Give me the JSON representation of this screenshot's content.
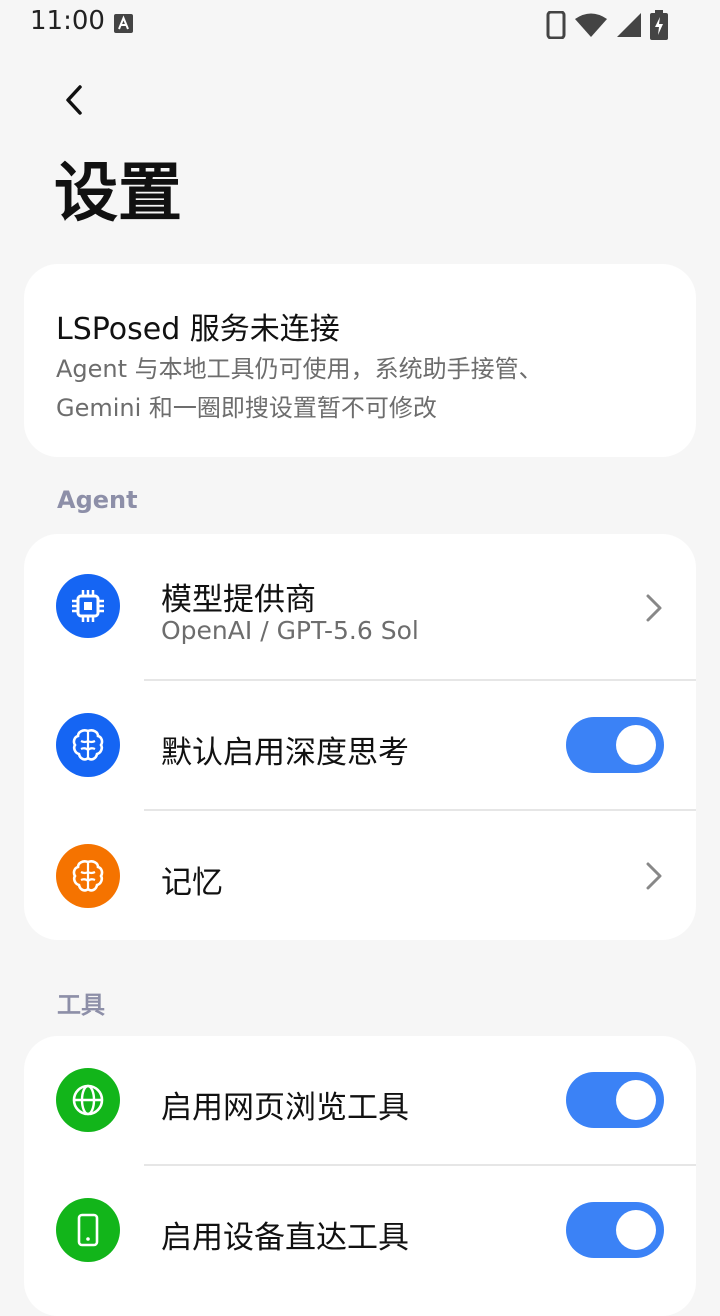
{
  "status_bar": {
    "time": "11:00"
  },
  "header": {
    "title": "设置"
  },
  "lsposed_card": {
    "title": "LSPosed 服务未连接",
    "desc_line1": "Agent 与本地工具仍可使用，系统助手接管、",
    "desc_line2": "Gemini 和一圈即搜设置暂不可修改"
  },
  "sections": {
    "agent_label": "Agent",
    "tools_label": "工具"
  },
  "agent_rows": {
    "model": {
      "title": "模型提供商",
      "subtitle": "OpenAI / GPT-5.6 Sol",
      "icon": "chip-icon",
      "color": "#1565f3"
    },
    "deep_think": {
      "title": "默认启用深度思考",
      "enabled": true,
      "icon": "brain-icon",
      "color": "#1565f3"
    },
    "memory": {
      "title": "记忆",
      "icon": "brain-icon",
      "color": "#f57300"
    }
  },
  "tool_rows": {
    "web": {
      "title": "启用网页浏览工具",
      "enabled": true,
      "icon": "globe-icon",
      "color": "#12b51a"
    },
    "device": {
      "title": "启用设备直达工具",
      "enabled": true,
      "icon": "phone-icon",
      "color": "#12b51a"
    }
  },
  "colors": {
    "toggle_on": "#3b82f6",
    "section_label": "#8d8fa8"
  }
}
